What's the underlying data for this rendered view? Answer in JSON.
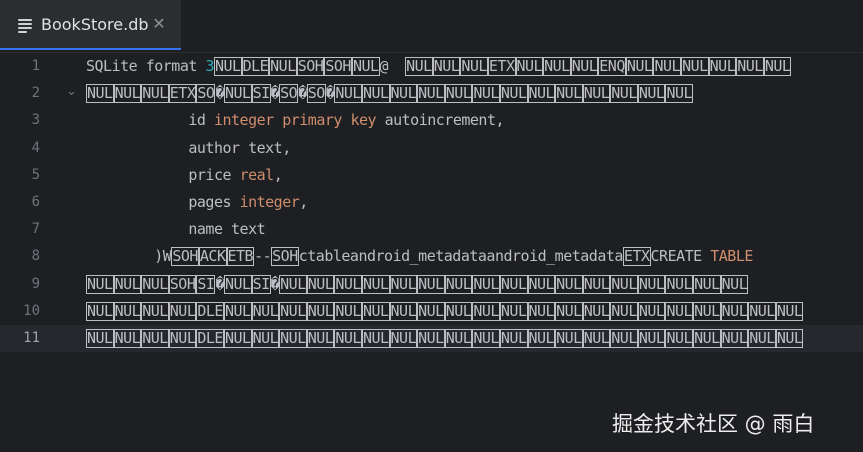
{
  "tab": {
    "icon": "text-file-icon",
    "title": "BookStore.db",
    "close_icon": "close-icon",
    "close_glyph": "✕"
  },
  "gutter": {
    "fold_icon": "chevron-down-icon",
    "fold_glyph": "⌄",
    "current_line": 11
  },
  "lines": [
    {
      "number": "1",
      "segments": [
        {
          "t": "SQLite format "
        },
        {
          "t": "3",
          "c": "num"
        },
        {
          "t": "NUL",
          "c": "ctl"
        },
        {
          "t": "DLE",
          "c": "ctl"
        },
        {
          "t": "NUL",
          "c": "ctl"
        },
        {
          "t": "SOH",
          "c": "ctl"
        },
        {
          "t": "SOH",
          "c": "ctl"
        },
        {
          "t": "NUL",
          "c": "ctl"
        },
        {
          "t": "@  "
        },
        {
          "t": "NUL",
          "c": "ctl"
        },
        {
          "t": "NUL",
          "c": "ctl"
        },
        {
          "t": "NUL",
          "c": "ctl"
        },
        {
          "t": "ETX",
          "c": "ctl"
        },
        {
          "t": "NUL",
          "c": "ctl"
        },
        {
          "t": "NUL",
          "c": "ctl"
        },
        {
          "t": "NUL",
          "c": "ctl"
        },
        {
          "t": "ENQ",
          "c": "ctl"
        },
        {
          "t": "NUL",
          "c": "ctl"
        },
        {
          "t": "NUL",
          "c": "ctl"
        },
        {
          "t": "NUL",
          "c": "ctl"
        },
        {
          "t": "NUL",
          "c": "ctl"
        },
        {
          "t": "NUL",
          "c": "ctl"
        },
        {
          "t": "NUL",
          "c": "ctl"
        }
      ]
    },
    {
      "number": "2",
      "fold": true,
      "segments": [
        {
          "t": "NUL",
          "c": "ctl"
        },
        {
          "t": "NUL",
          "c": "ctl"
        },
        {
          "t": "NUL",
          "c": "ctl"
        },
        {
          "t": "ETX",
          "c": "ctl"
        },
        {
          "t": "SO",
          "c": "ctl"
        },
        {
          "t": "�"
        },
        {
          "t": "NUL",
          "c": "ctl"
        },
        {
          "t": "SI",
          "c": "ctl"
        },
        {
          "t": "�"
        },
        {
          "t": "SO",
          "c": "ctl"
        },
        {
          "t": "�"
        },
        {
          "t": "SO",
          "c": "ctl"
        },
        {
          "t": "�"
        },
        {
          "t": "NUL",
          "c": "ctl"
        },
        {
          "t": "NUL",
          "c": "ctl"
        },
        {
          "t": "NUL",
          "c": "ctl"
        },
        {
          "t": "NUL",
          "c": "ctl"
        },
        {
          "t": "NUL",
          "c": "ctl"
        },
        {
          "t": "NUL",
          "c": "ctl"
        },
        {
          "t": "NUL",
          "c": "ctl"
        },
        {
          "t": "NUL",
          "c": "ctl"
        },
        {
          "t": "NUL",
          "c": "ctl"
        },
        {
          "t": "NUL",
          "c": "ctl"
        },
        {
          "t": "NUL",
          "c": "ctl"
        },
        {
          "t": "NUL",
          "c": "ctl"
        },
        {
          "t": "NUL",
          "c": "ctl"
        }
      ]
    },
    {
      "number": "3",
      "segments": [
        {
          "t": "            id "
        },
        {
          "t": "integer primary key",
          "c": "kw"
        },
        {
          "t": " autoincrement,"
        }
      ]
    },
    {
      "number": "4",
      "segments": [
        {
          "t": "            author text,"
        }
      ]
    },
    {
      "number": "5",
      "segments": [
        {
          "t": "            price "
        },
        {
          "t": "real",
          "c": "kw"
        },
        {
          "t": ","
        }
      ]
    },
    {
      "number": "6",
      "segments": [
        {
          "t": "            pages "
        },
        {
          "t": "integer",
          "c": "kw"
        },
        {
          "t": ","
        }
      ]
    },
    {
      "number": "7",
      "segments": [
        {
          "t": "            name text"
        }
      ]
    },
    {
      "number": "8",
      "segments": [
        {
          "t": "        )W"
        },
        {
          "t": "SOH",
          "c": "ctl"
        },
        {
          "t": "ACK",
          "c": "ctl"
        },
        {
          "t": "ETB",
          "c": "ctl"
        },
        {
          "t": "--"
        },
        {
          "t": "SOH",
          "c": "ctl"
        },
        {
          "t": "ctableandroid_metadataandroid_metadata"
        },
        {
          "t": "ETX",
          "c": "ctl"
        },
        {
          "t": "CREATE "
        },
        {
          "t": "TABLE",
          "c": "kw"
        }
      ]
    },
    {
      "number": "9",
      "segments": [
        {
          "t": "NUL",
          "c": "ctl"
        },
        {
          "t": "NUL",
          "c": "ctl"
        },
        {
          "t": "NUL",
          "c": "ctl"
        },
        {
          "t": "SOH",
          "c": "ctl"
        },
        {
          "t": "SI",
          "c": "ctl"
        },
        {
          "t": "�"
        },
        {
          "t": "NUL",
          "c": "ctl"
        },
        {
          "t": "SI",
          "c": "ctl"
        },
        {
          "t": "�"
        },
        {
          "t": "NUL",
          "c": "ctl"
        },
        {
          "t": "NUL",
          "c": "ctl"
        },
        {
          "t": "NUL",
          "c": "ctl"
        },
        {
          "t": "NUL",
          "c": "ctl"
        },
        {
          "t": "NUL",
          "c": "ctl"
        },
        {
          "t": "NUL",
          "c": "ctl"
        },
        {
          "t": "NUL",
          "c": "ctl"
        },
        {
          "t": "NUL",
          "c": "ctl"
        },
        {
          "t": "NUL",
          "c": "ctl"
        },
        {
          "t": "NUL",
          "c": "ctl"
        },
        {
          "t": "NUL",
          "c": "ctl"
        },
        {
          "t": "NUL",
          "c": "ctl"
        },
        {
          "t": "NUL",
          "c": "ctl"
        },
        {
          "t": "NUL",
          "c": "ctl"
        },
        {
          "t": "NUL",
          "c": "ctl"
        },
        {
          "t": "NUL",
          "c": "ctl"
        },
        {
          "t": "NUL",
          "c": "ctl"
        }
      ]
    },
    {
      "number": "10",
      "segments": [
        {
          "t": "NUL",
          "c": "ctl"
        },
        {
          "t": "NUL",
          "c": "ctl"
        },
        {
          "t": "NUL",
          "c": "ctl"
        },
        {
          "t": "NUL",
          "c": "ctl"
        },
        {
          "t": "DLE",
          "c": "ctl"
        },
        {
          "t": "NUL",
          "c": "ctl"
        },
        {
          "t": "NUL",
          "c": "ctl"
        },
        {
          "t": "NUL",
          "c": "ctl"
        },
        {
          "t": "NUL",
          "c": "ctl"
        },
        {
          "t": "NUL",
          "c": "ctl"
        },
        {
          "t": "NUL",
          "c": "ctl"
        },
        {
          "t": "NUL",
          "c": "ctl"
        },
        {
          "t": "NUL",
          "c": "ctl"
        },
        {
          "t": "NUL",
          "c": "ctl"
        },
        {
          "t": "NUL",
          "c": "ctl"
        },
        {
          "t": "NUL",
          "c": "ctl"
        },
        {
          "t": "NUL",
          "c": "ctl"
        },
        {
          "t": "NUL",
          "c": "ctl"
        },
        {
          "t": "NUL",
          "c": "ctl"
        },
        {
          "t": "NUL",
          "c": "ctl"
        },
        {
          "t": "NUL",
          "c": "ctl"
        },
        {
          "t": "NUL",
          "c": "ctl"
        },
        {
          "t": "NUL",
          "c": "ctl"
        },
        {
          "t": "NUL",
          "c": "ctl"
        },
        {
          "t": "NUL",
          "c": "ctl"
        },
        {
          "t": "NUL",
          "c": "ctl"
        }
      ]
    },
    {
      "number": "11",
      "segments": [
        {
          "t": "NUL",
          "c": "ctl"
        },
        {
          "t": "NUL",
          "c": "ctl"
        },
        {
          "t": "NUL",
          "c": "ctl"
        },
        {
          "t": "NUL",
          "c": "ctl"
        },
        {
          "t": "DLE",
          "c": "ctl"
        },
        {
          "t": "NUL",
          "c": "ctl"
        },
        {
          "t": "NUL",
          "c": "ctl"
        },
        {
          "t": "NUL",
          "c": "ctl"
        },
        {
          "t": "NUL",
          "c": "ctl"
        },
        {
          "t": "NUL",
          "c": "ctl"
        },
        {
          "t": "NUL",
          "c": "ctl"
        },
        {
          "t": "NUL",
          "c": "ctl"
        },
        {
          "t": "NUL",
          "c": "ctl"
        },
        {
          "t": "NUL",
          "c": "ctl"
        },
        {
          "t": "NUL",
          "c": "ctl"
        },
        {
          "t": "NUL",
          "c": "ctl"
        },
        {
          "t": "NUL",
          "c": "ctl"
        },
        {
          "t": "NUL",
          "c": "ctl"
        },
        {
          "t": "NUL",
          "c": "ctl"
        },
        {
          "t": "NUL",
          "c": "ctl"
        },
        {
          "t": "NUL",
          "c": "ctl"
        },
        {
          "t": "NUL",
          "c": "ctl"
        },
        {
          "t": "NUL",
          "c": "ctl"
        },
        {
          "t": "NUL",
          "c": "ctl"
        },
        {
          "t": "NUL",
          "c": "ctl"
        },
        {
          "t": "NUL",
          "c": "ctl"
        }
      ]
    }
  ],
  "watermark": "掘金技术社区 @ 雨白",
  "colors": {
    "background": "#1e1f22",
    "tab_background": "#2b2d30",
    "tab_accent": "#3574f0",
    "text": "#bcbec4",
    "keyword": "#cf8e6d",
    "number": "#2aacb8",
    "line_number": "#6f737a",
    "current_line": "#26282e"
  }
}
